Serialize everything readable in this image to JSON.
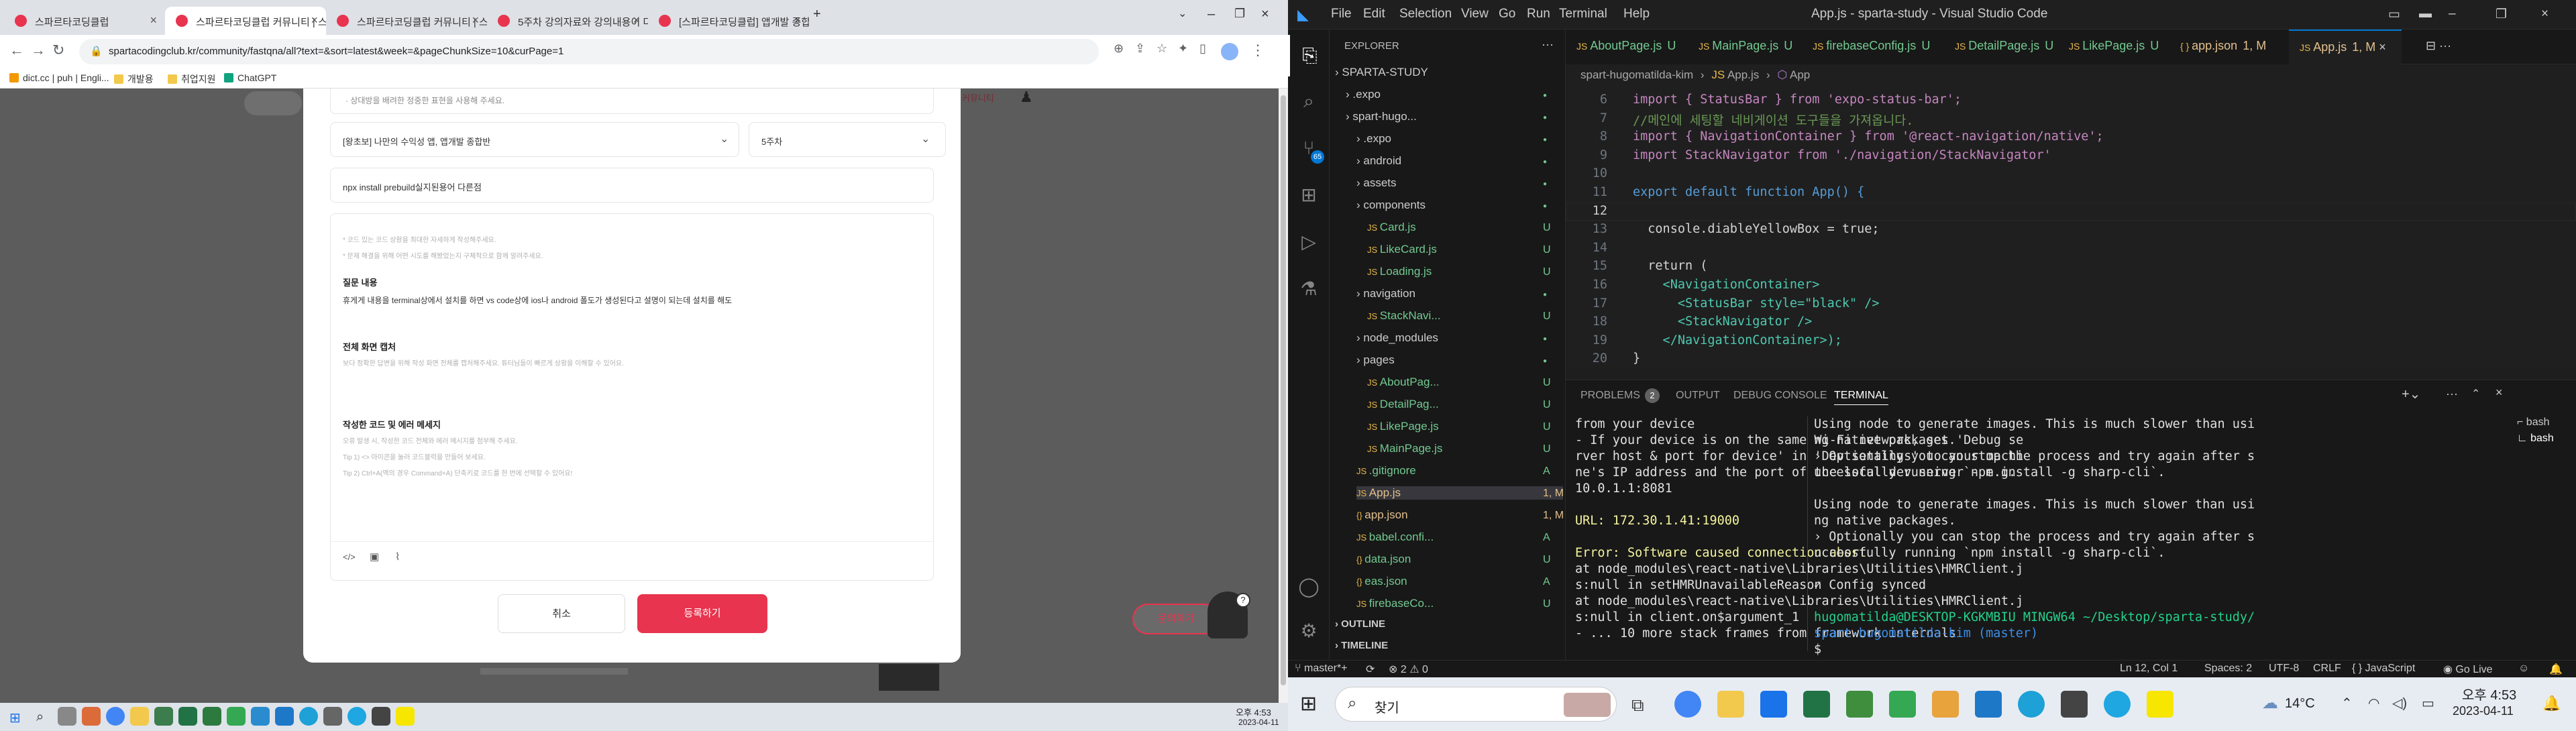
{
  "browser": {
    "tabs": [
      {
        "label": "스파르타코딩클럽"
      },
      {
        "label": "스파르타코딩클럽 커뮤니티 | 스"
      },
      {
        "label": "스파르타코딩클럽 커뮤니티 | 스"
      },
      {
        "label": "5주차 강의자료와 강의내용이 다"
      },
      {
        "label": "[스파르타코딩클럽] 앱개발 종합반"
      }
    ],
    "url": "spartacodingclub.kr/community/fastqna/all?text=&sort=latest&week=&pageChunkSize=10&curPage=1",
    "bookmarks": [
      "dict.cc | puh | Engli...",
      "개발용",
      "취업지원",
      "ChatGPT"
    ]
  },
  "modal": {
    "notice": "· 상대방을 배려한 정중한 표현을 사용해 주세요.",
    "course_select": "[왕초보] 나만의 수익성 앱, 앱개발 종합반",
    "week_select": "5주차",
    "title_value": "npx install prebuild실지된용어 다른점",
    "hint_1": "* 코드 있는 코드 상황을 최대한 자세하게 작성해주세요.",
    "hint_2": "* 문제 해결을 위해 어떤 시도를 해봤었는지 구체적으로 함께 알려주세요.",
    "question_heading": "질문 내용",
    "question_text": "휴게게 내용을 terminal상에서 설치를 하면 vs code상에 ios나 android 폴도가 생성된다고 설명이 되는데 설치를 해도",
    "screen_heading": "전체 화면 캡처",
    "screen_hint": "보다 정확한 답변을 위해 작성 화면 전체를 캡처해주세요. 튜터님들이 빠르게 상황을 이해할 수 있어요.",
    "code_heading": "작성한 코드 및 에러 메세지",
    "code_hint_1": "오류 발생 시, 작성한 코드 전체와 에러 메시지를 첨부해 주세요.",
    "code_hint_2": "Tip 1) <> 아이콘을 눌러 코드블럭을 만들어 보세요.",
    "code_hint_3": "Tip 2) Ctrl+A(맥의 경우 Command+A) 단축키로 코드를 한 번에 선택할 수 있어요!",
    "cancel_label": "취소",
    "submit_label": "등록하기",
    "bg_right_text": "커뮤니티",
    "inquiry_label": "문의하기"
  },
  "vscode": {
    "menus": [
      "File",
      "Edit",
      "Selection",
      "View",
      "Go",
      "Run",
      "Terminal",
      "Help"
    ],
    "window_title": "App.js - sparta-study - Visual Studio Code",
    "explorer_title": "EXPLORER",
    "tree": [
      {
        "name": "SPARTA-STUDY",
        "status": "",
        "depth": 0
      },
      {
        "name": ".expo",
        "status": "",
        "depth": 1
      },
      {
        "name": "spart-hugo...",
        "status": "",
        "depth": 1
      },
      {
        "name": ".expo",
        "status": "",
        "depth": 2
      },
      {
        "name": "android",
        "status": "",
        "depth": 2
      },
      {
        "name": "assets",
        "status": "",
        "depth": 2
      },
      {
        "name": "components",
        "status": "",
        "depth": 2
      },
      {
        "name": "Card.js",
        "status": "U",
        "depth": 3
      },
      {
        "name": "LikeCard.js",
        "status": "U",
        "depth": 3
      },
      {
        "name": "Loading.js",
        "status": "U",
        "depth": 3
      },
      {
        "name": "navigation",
        "status": "",
        "depth": 2
      },
      {
        "name": "StackNavi...",
        "status": "U",
        "depth": 3
      },
      {
        "name": "node_modules",
        "status": "",
        "depth": 2
      },
      {
        "name": "pages",
        "status": "",
        "depth": 2
      },
      {
        "name": "AboutPag...",
        "status": "U",
        "depth": 3
      },
      {
        "name": "DetailPag...",
        "status": "U",
        "depth": 3
      },
      {
        "name": "LikePage.js",
        "status": "U",
        "depth": 3
      },
      {
        "name": "MainPage.js",
        "status": "U",
        "depth": 3
      },
      {
        "name": ".gitignore",
        "status": "A",
        "depth": 2
      },
      {
        "name": "App.js",
        "status": "1, M",
        "depth": 2
      },
      {
        "name": "app.json",
        "status": "1, M",
        "depth": 2
      },
      {
        "name": "babel.confi...",
        "status": "A",
        "depth": 2
      },
      {
        "name": "data.json",
        "status": "U",
        "depth": 2
      },
      {
        "name": "eas.json",
        "status": "A",
        "depth": 2
      },
      {
        "name": "firebaseCo...",
        "status": "U",
        "depth": 2
      }
    ],
    "outline": "OUTLINE",
    "timeline": "TIMELINE",
    "editor_tabs": [
      {
        "label": "AboutPage.js",
        "status": "U"
      },
      {
        "label": "MainPage.js",
        "status": "U"
      },
      {
        "label": "firebaseConfig.js",
        "status": "U"
      },
      {
        "label": "DetailPage.js",
        "status": "U"
      },
      {
        "label": "LikePage.js",
        "status": "U"
      },
      {
        "label": "app.json",
        "status": "1, M"
      },
      {
        "label": "App.js",
        "status": "1, M"
      }
    ],
    "breadcrumb": [
      "spart-hugomatilda-kim",
      "App.js",
      "App"
    ],
    "code_lines": [
      {
        "n": "6",
        "text": "import { StatusBar } from 'expo-status-bar';"
      },
      {
        "n": "7",
        "text": "//메인에 세팅할 네비게이션 도구들을 가져옵니다."
      },
      {
        "n": "8",
        "text": "import { NavigationContainer } from '@react-navigation/native';"
      },
      {
        "n": "9",
        "text": "import StackNavigator from './navigation/StackNavigator'"
      },
      {
        "n": "10",
        "text": ""
      },
      {
        "n": "11",
        "text": "export default function App() {"
      },
      {
        "n": "12",
        "text": ""
      },
      {
        "n": "13",
        "text": "  console.diableYellowBox = true;"
      },
      {
        "n": "14",
        "text": ""
      },
      {
        "n": "15",
        "text": "  return ("
      },
      {
        "n": "16",
        "text": "    <NavigationContainer>"
      },
      {
        "n": "17",
        "text": "      <StatusBar style=\"black\" />"
      },
      {
        "n": "18",
        "text": "      <StackNavigator />"
      },
      {
        "n": "19",
        "text": "    </NavigationContainer>);"
      },
      {
        "n": "20",
        "text": "}"
      }
    ],
    "panel_tabs": [
      "PROBLEMS",
      "OUTPUT",
      "DEBUG CONSOLE",
      "TERMINAL"
    ],
    "problems_count": "2",
    "terminal_left": [
      "from your device",
      "- If your device is on the same Wi-Fi network, set 'Debug se",
      "rver host & port for device' in 'Dev settings' to your machi",
      "ne's IP address and the port of the local dev server - e.g.",
      "10.0.1.1:8081",
      "",
      "URL: 172.30.1.41:19000",
      "",
      "Error: Software caused connection abort",
      "at node_modules\\react-native\\Libraries\\Utilities\\HMRClient.j",
      "s:null in setHMRUnavailableReason",
      "at node_modules\\react-native\\Libraries\\Utilities\\HMRClient.j",
      "s:null in client.on$argument_1",
      "- ... 10 more stack frames from framework internals"
    ],
    "terminal_right": [
      "Using node to generate images. This is much slower than usi",
      "ng native packages.",
      "› Optionally you can stop the process and try again after s",
      "uccessfully running `npm install -g sharp-cli`.",
      "",
      "Using node to generate images. This is much slower than usi",
      "ng native packages.",
      "› Optionally you can stop the process and try again after s",
      "uccessfully running `npm install -g sharp-cli`.",
      "",
      "✓ Config synced",
      "",
      "hugomatilda@DESKTOP-KGKMBIU MINGW64 ~/Desktop/sparta-study/",
      "spart-hugomatilda-kim (master)",
      "$ "
    ],
    "terminals": [
      "bash",
      "bash"
    ],
    "status": {
      "branch": "master*+",
      "errors": "2",
      "warnings": "0",
      "position": "Ln 12, Col 1",
      "spaces": "Spaces: 2",
      "encoding": "UTF-8",
      "eol": "CRLF",
      "language": "JavaScript",
      "golive": "Go Live"
    }
  },
  "taskbar": {
    "search": "찾기",
    "weather": "14°C",
    "time": "오후 4:53",
    "date": "2023-04-11",
    "left_time": "오후 4:53",
    "left_date": "2023-04-11"
  }
}
